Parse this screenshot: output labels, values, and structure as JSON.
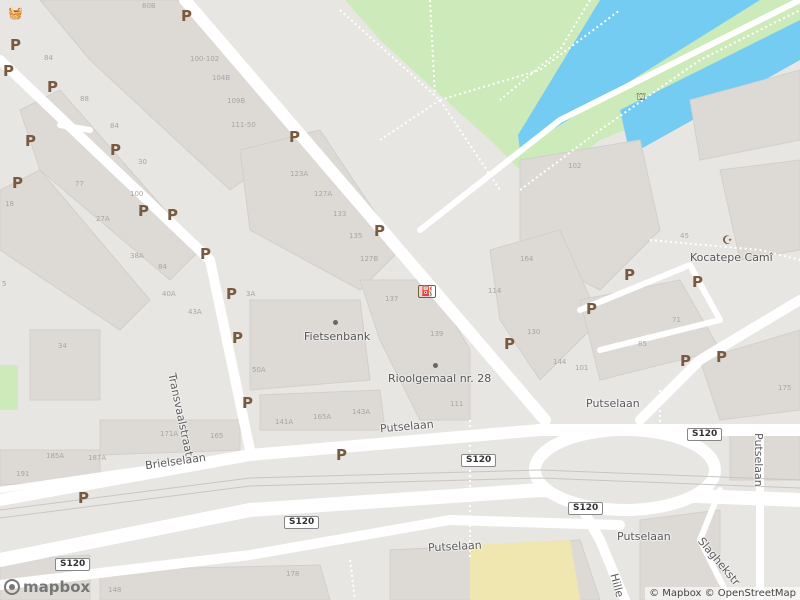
{
  "map": {
    "streets": {
      "transvaalstraat": "Transvaalstraat",
      "brielselaan": "Brielselaan",
      "putselaan_upper": "Putselaan",
      "putselaan_right": "Putselaan",
      "putselaan_lower": "Putselaan",
      "putselaan_bottom_right": "Putselaan",
      "putselaan_vertical": "Putselaan",
      "slaghekstraat": "Slaghekstr",
      "hillelaan": "Hille"
    },
    "pois": {
      "fietsenbank": "Fietsenbank",
      "rioolgemaal": "Rioolgemaal nr. 28",
      "kocatepe": "Kocatepe Camî"
    },
    "route_shields": [
      "S120",
      "S120",
      "S120",
      "S120",
      "S120"
    ],
    "parking_label": "P",
    "house_numbers": [
      "80B",
      "100-102",
      "104B",
      "84",
      "109B",
      "111-50",
      "30",
      "88",
      "84",
      "123A",
      "127A",
      "77",
      "133",
      "100",
      "18",
      "135",
      "27A",
      "127B",
      "38A",
      "84",
      "40A",
      "43A",
      "137",
      "34",
      "5",
      "139",
      "3A",
      "50A",
      "141A",
      "165A",
      "143A",
      "171A",
      "165",
      "185A",
      "187A",
      "191",
      "102",
      "45",
      "164",
      "114",
      "130",
      "71",
      "144",
      "85",
      "101",
      "111",
      "175",
      "178",
      "148"
    ]
  },
  "attribution": {
    "logo_text": "mapbox",
    "copyright": "© Mapbox © OpenStreetMap"
  }
}
